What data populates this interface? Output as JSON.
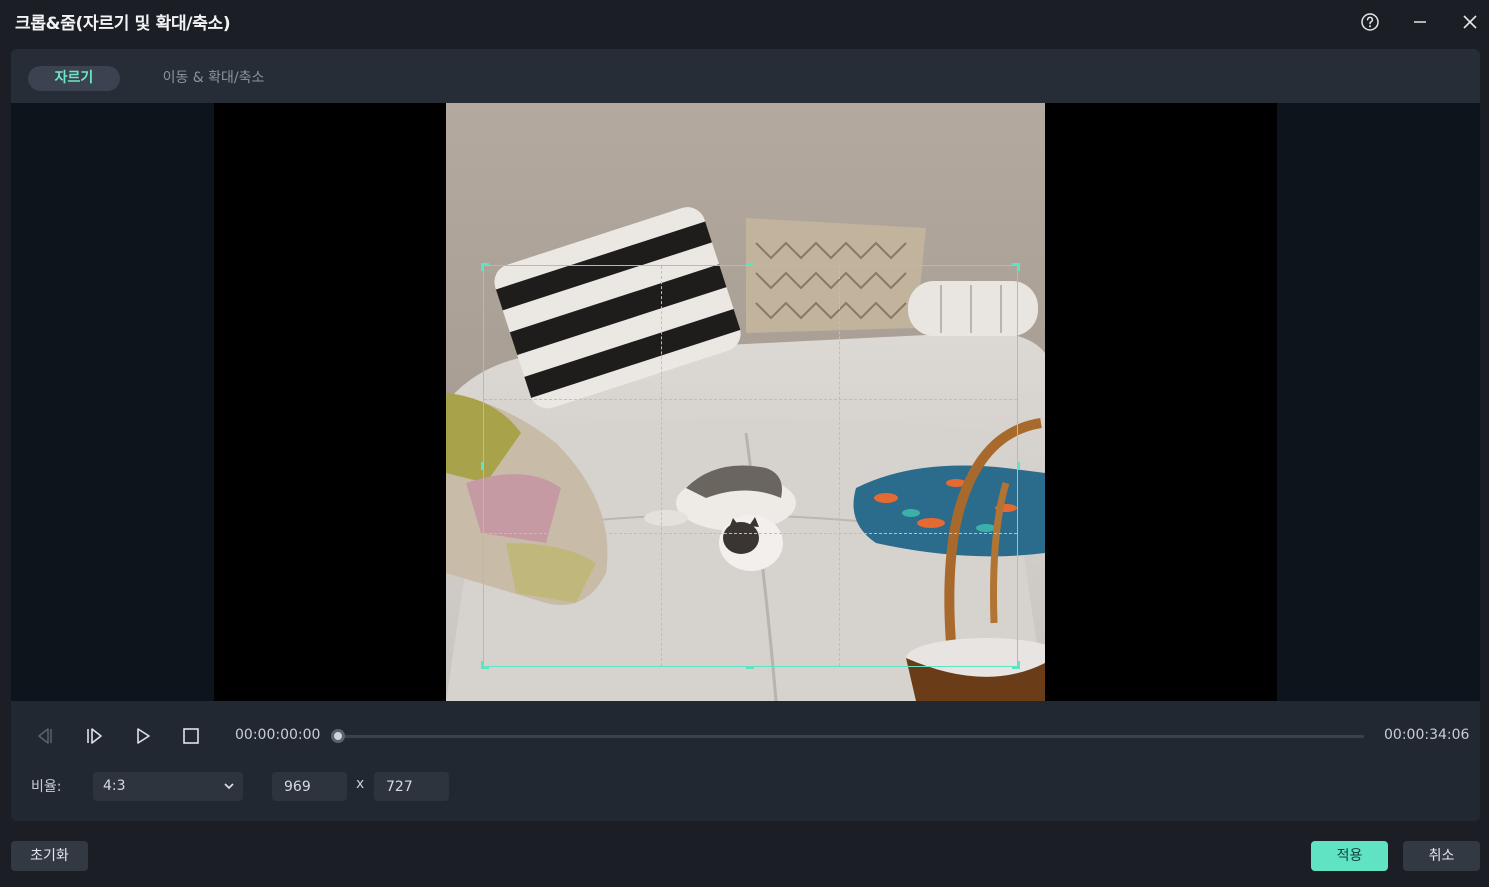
{
  "window": {
    "title": "크롭&줌(자르기 및 확대/축소)",
    "icons": [
      "help-icon",
      "minimize-icon",
      "close-icon"
    ]
  },
  "tabs": [
    {
      "label": "자르기",
      "active": true
    },
    {
      "label": "이동 & 확대/축소",
      "active": false
    }
  ],
  "playback": {
    "current_time": "00:00:00:00",
    "total_time": "00:00:34:06",
    "progress": 0,
    "buttons": [
      "prev-frame-icon",
      "next-frame-icon",
      "play-icon",
      "stop-icon"
    ]
  },
  "crop": {
    "ratio_label": "비율:",
    "ratio_value": "4:3",
    "width": "969",
    "height": "727",
    "separator": "x"
  },
  "footer": {
    "reset_label": "초기화",
    "apply_label": "적용",
    "cancel_label": "취소"
  },
  "colors": {
    "accent": "#5fe3c3",
    "background": "#1b1f25",
    "panel": "#222831"
  }
}
